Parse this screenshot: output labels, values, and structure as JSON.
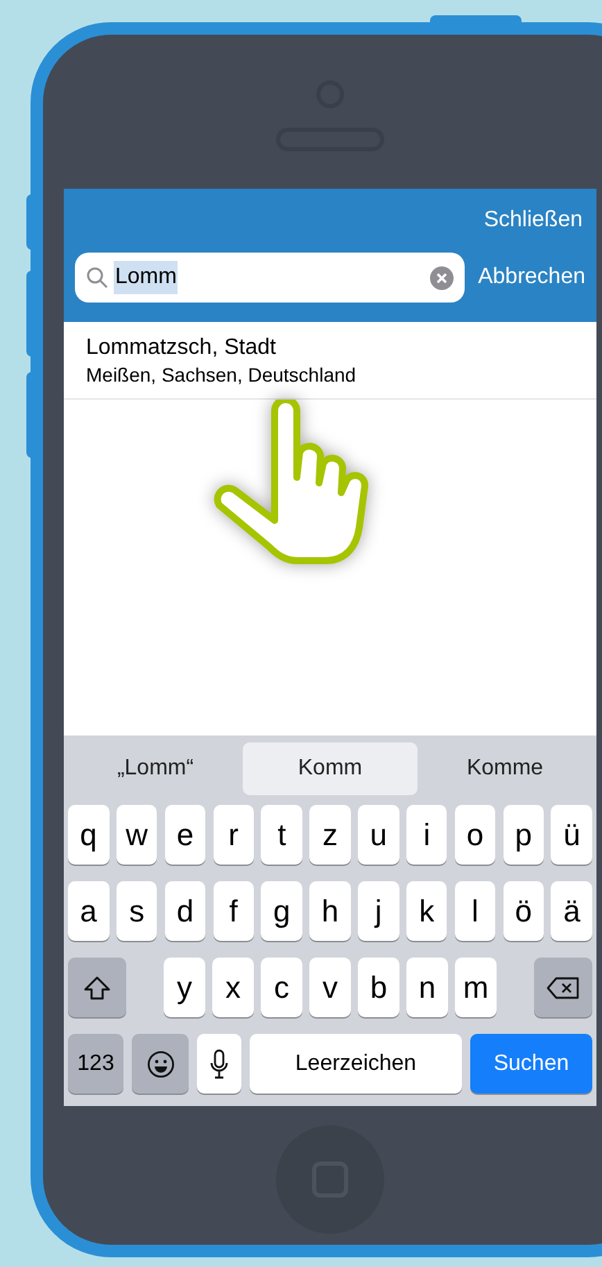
{
  "header": {
    "close_label": "Schließen"
  },
  "search": {
    "value": "Lomm",
    "text_selected": true,
    "cancel_label": "Abbrechen"
  },
  "results": [
    {
      "title": "Lommatzsch, Stadt",
      "subtitle": "Meißen, Sachsen, Deutschland"
    }
  ],
  "keyboard": {
    "suggestions": [
      {
        "label": "„Lomm“",
        "selected": false
      },
      {
        "label": "Komm",
        "selected": true
      },
      {
        "label": "Komme",
        "selected": false
      }
    ],
    "rows": [
      [
        "q",
        "w",
        "e",
        "r",
        "t",
        "z",
        "u",
        "i",
        "o",
        "p",
        "ü"
      ],
      [
        "a",
        "s",
        "d",
        "f",
        "g",
        "h",
        "j",
        "k",
        "l",
        "ö",
        "ä"
      ]
    ],
    "shift_row_letters": [
      "y",
      "x",
      "c",
      "v",
      "b",
      "n",
      "m"
    ],
    "numbers_key": "123",
    "space_key": "Leerzeichen",
    "action_key": "Suchen"
  }
}
